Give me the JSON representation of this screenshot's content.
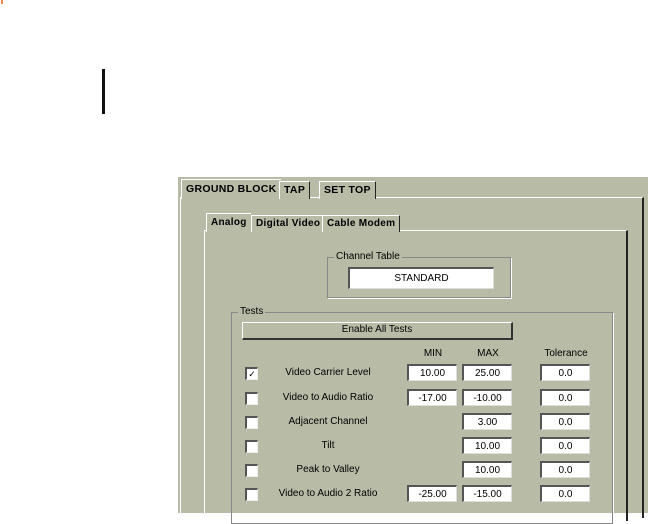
{
  "outer_tabs": [
    "GROUND BLOCK",
    "TAP",
    "SET TOP"
  ],
  "inner_tabs": [
    "Analog",
    "Digital Video",
    "Cable Modem"
  ],
  "channel_table": {
    "legend": "Channel Table",
    "value": "STANDARD"
  },
  "tests": {
    "legend": "Tests",
    "enable_all_label": "Enable All Tests",
    "headers": {
      "min": "MIN",
      "max": "MAX",
      "tolerance": "Tolerance"
    },
    "rows": [
      {
        "name": "Video Carrier Level",
        "checked": true,
        "check": "✓",
        "min": "10.00",
        "max": "25.00",
        "tolerance": "0.0"
      },
      {
        "name": "Video to Audio Ratio",
        "checked": false,
        "min": "-17.00",
        "max": "-10.00",
        "tolerance": "0.0"
      },
      {
        "name": "Adjacent Channel",
        "checked": false,
        "max": "3.00",
        "tolerance": "0.0"
      },
      {
        "name": "Tilt",
        "checked": false,
        "max": "10.00",
        "tolerance": "0.0"
      },
      {
        "name": "Peak to Valley",
        "checked": false,
        "max": "10.00",
        "tolerance": "0.0"
      },
      {
        "name": "Video to Audio 2 Ratio",
        "checked": false,
        "min": "-25.00",
        "max": "-15.00",
        "tolerance": "0.0"
      }
    ]
  }
}
